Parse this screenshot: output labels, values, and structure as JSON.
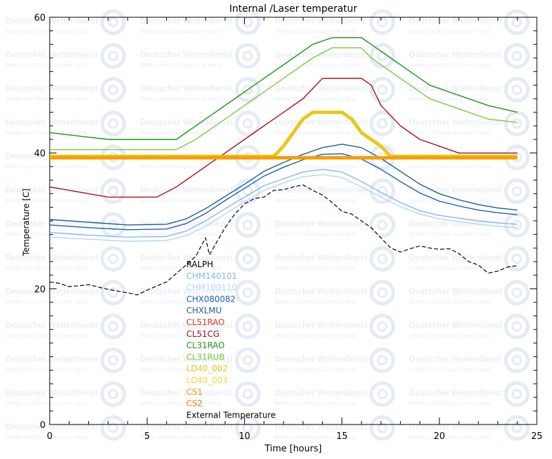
{
  "chart_data": {
    "type": "line",
    "title": "Internal /Laser temperatur",
    "xlabel": "Time [hours]",
    "ylabel": "Temperature [C]",
    "xlim": [
      0,
      25
    ],
    "ylim": [
      0,
      60
    ],
    "x_ticks": [
      0,
      5,
      10,
      15,
      20,
      25
    ],
    "y_ticks": [
      0,
      20,
      40,
      60
    ],
    "x_ticks_labels": [
      "0",
      "5",
      "10",
      "15",
      "20",
      "25"
    ],
    "y_ticks_labels": [
      "0",
      "20",
      "40",
      "60"
    ],
    "grid": false,
    "legend_position": "left-center",
    "watermark": {
      "name": "Deutscher Wetterdienst",
      "tagline": "Wetter und Klima aus einer Hand",
      "logo": "DWD"
    },
    "series": [
      {
        "name": "RALPH",
        "color": "#000000",
        "points": []
      },
      {
        "name": "CHM140101",
        "color": "#86b6e8",
        "points": [
          [
            0,
            28.3
          ],
          [
            2,
            27.9
          ],
          [
            4,
            27.6
          ],
          [
            6,
            27.7
          ],
          [
            7,
            28.5
          ],
          [
            8,
            30
          ],
          [
            9,
            31.8
          ],
          [
            10,
            33.5
          ],
          [
            11,
            35.2
          ],
          [
            12,
            36.2
          ],
          [
            13,
            37.2
          ],
          [
            14,
            37.6
          ],
          [
            15,
            37.2
          ],
          [
            16,
            35.8
          ],
          [
            17,
            34.2
          ],
          [
            18,
            32.7
          ],
          [
            19,
            31.5
          ],
          [
            20,
            30.8
          ],
          [
            21,
            30.4
          ],
          [
            22,
            30
          ],
          [
            23,
            29.7
          ],
          [
            24,
            29.5
          ]
        ]
      },
      {
        "name": "CHM100110",
        "color": "#b7d5f4",
        "points": [
          [
            0,
            27.6
          ],
          [
            2,
            27.3
          ],
          [
            4,
            27
          ],
          [
            6,
            27.1
          ],
          [
            7,
            27.8
          ],
          [
            8,
            29.2
          ],
          [
            9,
            31
          ],
          [
            10,
            32.8
          ],
          [
            11,
            34.5
          ],
          [
            12,
            35.6
          ],
          [
            13,
            36.5
          ],
          [
            14,
            36.8
          ],
          [
            15,
            36.4
          ],
          [
            16,
            35
          ],
          [
            17,
            33.5
          ],
          [
            18,
            32.1
          ],
          [
            19,
            31
          ],
          [
            20,
            30.3
          ],
          [
            21,
            29.9
          ],
          [
            22,
            29.5
          ],
          [
            23,
            29.2
          ],
          [
            24,
            29
          ]
        ]
      },
      {
        "name": "CHX080082",
        "color": "#1f5fb0",
        "points": [
          [
            0,
            29.4
          ],
          [
            2,
            29
          ],
          [
            4,
            28.7
          ],
          [
            6,
            28.8
          ],
          [
            7,
            29.6
          ],
          [
            8,
            31.1
          ],
          [
            9,
            33
          ],
          [
            10,
            34.8
          ],
          [
            11,
            36.6
          ],
          [
            12,
            37.9
          ],
          [
            13,
            39
          ],
          [
            14,
            39.8
          ],
          [
            15,
            39.9
          ],
          [
            16,
            39.1
          ],
          [
            17,
            37.6
          ],
          [
            18,
            35.8
          ],
          [
            19,
            34.1
          ],
          [
            20,
            32.9
          ],
          [
            21,
            32.2
          ],
          [
            22,
            31.6
          ],
          [
            23,
            31.2
          ],
          [
            24,
            30.9
          ]
        ]
      },
      {
        "name": "CHXLMU",
        "color": "#1b5e8e",
        "points": [
          [
            0,
            30.2
          ],
          [
            2,
            29.8
          ],
          [
            4,
            29.4
          ],
          [
            6,
            29.5
          ],
          [
            7,
            30.3
          ],
          [
            8,
            31.8
          ],
          [
            9,
            33.6
          ],
          [
            10,
            35.4
          ],
          [
            11,
            37.3
          ],
          [
            12,
            38.6
          ],
          [
            13,
            39.8
          ],
          [
            14,
            40.8
          ],
          [
            15,
            41.3
          ],
          [
            16,
            40.8
          ],
          [
            17,
            39.2
          ],
          [
            18,
            37.3
          ],
          [
            19,
            35.4
          ],
          [
            20,
            34
          ],
          [
            21,
            33.1
          ],
          [
            22,
            32.4
          ],
          [
            23,
            31.9
          ],
          [
            24,
            31.6
          ]
        ]
      },
      {
        "name": "CL51RAO",
        "color": "#e8361a",
        "points": []
      },
      {
        "name": "CL51CG",
        "color": "#a80f0f",
        "points": [
          [
            0,
            35
          ],
          [
            3,
            33.5
          ],
          [
            5.5,
            33.5
          ],
          [
            6.5,
            35
          ],
          [
            7,
            36
          ],
          [
            7.5,
            37
          ],
          [
            8,
            38
          ],
          [
            9,
            40
          ],
          [
            10,
            42
          ],
          [
            11,
            44
          ],
          [
            12,
            46
          ],
          [
            13,
            48
          ],
          [
            14,
            51
          ],
          [
            15,
            51
          ],
          [
            16,
            51
          ],
          [
            16.5,
            50
          ],
          [
            17,
            47
          ],
          [
            18,
            44
          ],
          [
            19,
            42
          ],
          [
            20,
            41
          ],
          [
            21,
            40
          ],
          [
            22,
            40
          ],
          [
            24,
            40
          ]
        ]
      },
      {
        "name": "CL31RAO",
        "color": "#169614",
        "points": [
          [
            0,
            43
          ],
          [
            3,
            42
          ],
          [
            6.5,
            42
          ],
          [
            7.5,
            44
          ],
          [
            8.5,
            46
          ],
          [
            9.5,
            48
          ],
          [
            10.5,
            50
          ],
          [
            11.5,
            52
          ],
          [
            12.5,
            54
          ],
          [
            13.5,
            56
          ],
          [
            14.5,
            57
          ],
          [
            16,
            57
          ],
          [
            16.5,
            56
          ],
          [
            17.5,
            54
          ],
          [
            18.5,
            52
          ],
          [
            19.5,
            50
          ],
          [
            20.5,
            49
          ],
          [
            21.5,
            48
          ],
          [
            22.5,
            47
          ],
          [
            24,
            46
          ]
        ]
      },
      {
        "name": "CL31RUB",
        "color": "#7cc840",
        "points": [
          [
            0,
            40.5
          ],
          [
            3,
            40.5
          ],
          [
            6.5,
            40.5
          ],
          [
            7.5,
            42
          ],
          [
            8.5,
            44
          ],
          [
            9.5,
            46
          ],
          [
            10.5,
            48
          ],
          [
            11.5,
            50
          ],
          [
            12.5,
            52
          ],
          [
            13.5,
            54
          ],
          [
            14.5,
            55.5
          ],
          [
            16,
            55.5
          ],
          [
            16.5,
            54
          ],
          [
            17.5,
            52
          ],
          [
            18.5,
            50
          ],
          [
            19.5,
            48
          ],
          [
            20.5,
            47
          ],
          [
            21.5,
            46
          ],
          [
            22.5,
            45
          ],
          [
            24,
            44.5
          ]
        ]
      },
      {
        "name": "LD40_002",
        "color": "#e8c81a",
        "points": [
          [
            0,
            39.5
          ],
          [
            11.5,
            39.5
          ],
          [
            12,
            41
          ],
          [
            12.5,
            43
          ],
          [
            13,
            45
          ],
          [
            13.5,
            46
          ],
          [
            15,
            46
          ],
          [
            15.5,
            45
          ],
          [
            16,
            43
          ],
          [
            17,
            41
          ],
          [
            17.5,
            39.5
          ],
          [
            24,
            39.5
          ]
        ]
      },
      {
        "name": "LD40_003",
        "color": "#ecd840",
        "points": []
      },
      {
        "name": "CS1",
        "color": "#f5a000",
        "points": [
          [
            0,
            39.3
          ],
          [
            24,
            39.3
          ]
        ]
      },
      {
        "name": "CS2",
        "color": "#f07818",
        "points": []
      },
      {
        "name": "External Temperature",
        "color": "#000000",
        "points": [
          [
            0,
            21
          ],
          [
            0.5,
            20.8
          ],
          [
            1,
            20.3
          ],
          [
            2,
            20.6
          ],
          [
            3,
            19.9
          ],
          [
            4,
            19.4
          ],
          [
            4.5,
            19.1
          ],
          [
            5,
            19.8
          ],
          [
            6,
            21
          ],
          [
            7,
            23.5
          ],
          [
            7.5,
            24.8
          ],
          [
            8,
            27.5
          ],
          [
            8.2,
            25
          ],
          [
            8.5,
            26.5
          ],
          [
            9,
            29
          ],
          [
            9.5,
            31
          ],
          [
            10,
            32.5
          ],
          [
            10.5,
            33.3
          ],
          [
            11,
            33.5
          ],
          [
            11.5,
            34.5
          ],
          [
            12,
            34.6
          ],
          [
            12.5,
            35
          ],
          [
            13,
            35.3
          ],
          [
            13.5,
            34.5
          ],
          [
            14,
            33.8
          ],
          [
            14.5,
            32.7
          ],
          [
            15,
            31.4
          ],
          [
            15.5,
            31
          ],
          [
            16,
            30
          ],
          [
            16.5,
            29
          ],
          [
            17,
            27.5
          ],
          [
            17.5,
            26
          ],
          [
            18,
            25.4
          ],
          [
            18.5,
            25.9
          ],
          [
            19,
            26.3
          ],
          [
            19.5,
            26
          ],
          [
            20,
            25.8
          ],
          [
            20.5,
            25.9
          ],
          [
            21,
            25.2
          ],
          [
            21.5,
            24
          ],
          [
            22,
            23.5
          ],
          [
            22.5,
            22.3
          ],
          [
            23,
            22.6
          ],
          [
            23.5,
            23.2
          ],
          [
            24,
            23.4
          ]
        ]
      }
    ]
  }
}
